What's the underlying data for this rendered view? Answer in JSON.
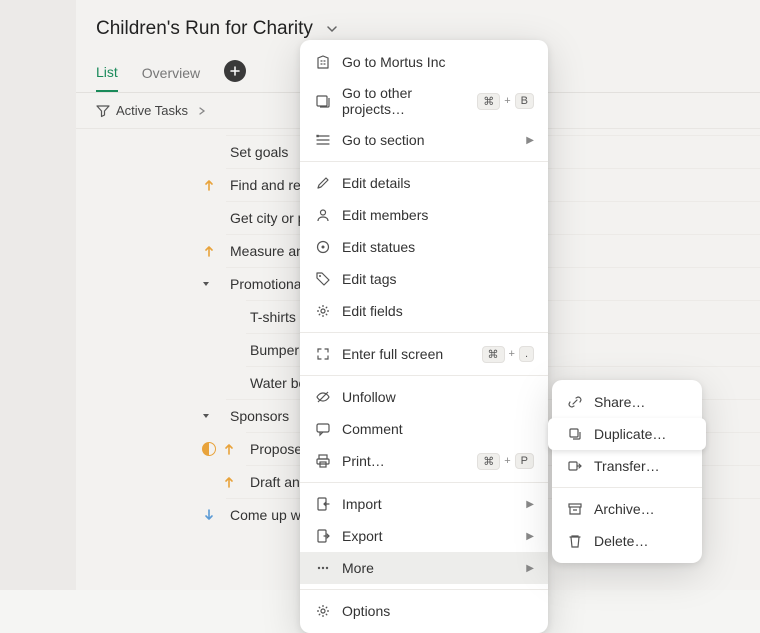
{
  "header": {
    "title": "Children's Run for Charity"
  },
  "tabs": {
    "list": "List",
    "overview": "Overview"
  },
  "filter": {
    "label": "Active Tasks"
  },
  "tasks": [
    {
      "text": "Set goals",
      "indent": 0,
      "icons": []
    },
    {
      "text": "Find and reserve loc",
      "indent": 0,
      "icons": [
        "up"
      ]
    },
    {
      "text": "Get city or police ap",
      "indent": 0,
      "icons": []
    },
    {
      "text": "Measure and map o",
      "indent": 0,
      "icons": [
        "up"
      ]
    },
    {
      "text": "Promotional items",
      "indent": 0,
      "icons": [
        "caret"
      ]
    },
    {
      "text": "T-shirts",
      "indent": 1,
      "icons": []
    },
    {
      "text": "Bumper stickers",
      "indent": 1,
      "icons": []
    },
    {
      "text": "Water bottles",
      "indent": 1,
      "icons": []
    },
    {
      "text": "Sponsors",
      "indent": 0,
      "icons": [
        "caret"
      ]
    },
    {
      "text": "Propose a list of",
      "indent": 1,
      "icons": [
        "half",
        "up"
      ]
    },
    {
      "text": "Draft and sign ag",
      "indent": 1,
      "icons": [
        "up"
      ]
    },
    {
      "text": "Come up with a list",
      "indent": 0,
      "icons": [
        "down"
      ]
    }
  ],
  "menu": {
    "go_mortus": "Go to Mortus Inc",
    "go_other": "Go to other projects…",
    "go_section": "Go to section",
    "edit_details": "Edit details",
    "edit_members": "Edit members",
    "edit_statues": "Edit statues",
    "edit_tags": "Edit tags",
    "edit_fields": "Edit fields",
    "full_screen": "Enter full screen",
    "unfollow": "Unfollow",
    "comment": "Comment",
    "print": "Print…",
    "import": "Import",
    "export": "Export",
    "more": "More",
    "options": "Options",
    "kbd_cmd": "⌘",
    "kbd_plus": "+",
    "kbd_B": "B",
    "kbd_dot": ".",
    "kbd_P": "P"
  },
  "submenu": {
    "share": "Share…",
    "duplicate": "Duplicate…",
    "transfer": "Transfer…",
    "archive": "Archive…",
    "delete": "Delete…"
  }
}
